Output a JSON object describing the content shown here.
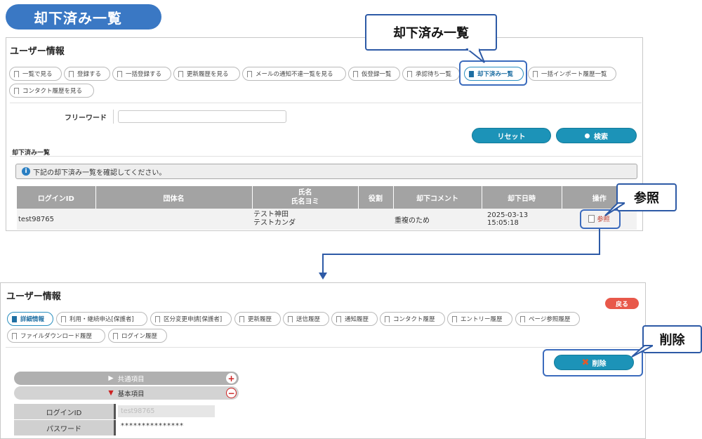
{
  "page_title": "却下済み一覧",
  "top": {
    "section_title": "ユーザー情報",
    "tabs": [
      "一覧で見る",
      "登録する",
      "一括登録する",
      "更新履歴を見る",
      "メールの通知不達一覧を見る",
      "仮登録一覧",
      "承認待ち一覧",
      "却下済み一覧",
      "一括インポート履歴一覧",
      "コンタクト履歴を見る"
    ],
    "free_word_label": "フリーワード",
    "free_word_value": "",
    "reset_label": "リセット",
    "search_label": "検索",
    "list_title": "却下済み一覧",
    "info_text": "下記の却下済み一覧を確認してください。",
    "table": {
      "headers": [
        "ログインID",
        "団体名",
        "氏名",
        "氏名ヨミ",
        "役割",
        "却下コメント",
        "却下日時",
        "操作"
      ],
      "rows": [
        {
          "login_id": "test98765",
          "org": "",
          "name": "テスト神田",
          "name_kana": "テストカンダ",
          "role": "",
          "comment": "重複のため",
          "date": "2025-03-13 15:05:18",
          "action": "参照"
        }
      ]
    }
  },
  "callouts": {
    "list": "却下済み一覧",
    "view": "参照",
    "delete": "削除"
  },
  "bottom": {
    "section_title": "ユーザー情報",
    "back_label": "戻る",
    "tabs": [
      "詳細情報",
      "利用・継続申込[保護者]",
      "区分変更申請[保護者]",
      "更新履歴",
      "送信履歴",
      "通知履歴",
      "コンタクト履歴",
      "エントリー履歴",
      "ページ参照履歴",
      "ファイルダウンロード履歴",
      "ログイン履歴"
    ],
    "delete_label": "削除",
    "accordion": [
      {
        "label": "共通項目",
        "sign": "+"
      },
      {
        "label": "基本項目",
        "sign": "−"
      }
    ],
    "fields": [
      {
        "label": "ログインID",
        "value": "test98765"
      },
      {
        "label": "パスワード",
        "value": "***************"
      }
    ]
  },
  "colors": {
    "accent": "#1c93b8",
    "title_pill": "#3a78c4",
    "callout_border": "#2d5aa6",
    "back_button": "#e8584a",
    "delete_icon": "#e05a2b"
  }
}
